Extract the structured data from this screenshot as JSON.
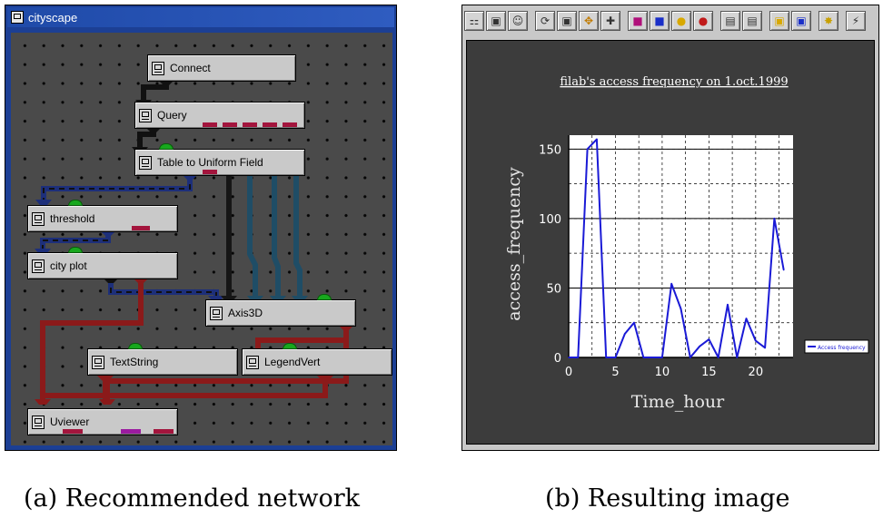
{
  "network_window": {
    "title": "cityscape",
    "modules": {
      "connect": "Connect",
      "query": "Query",
      "table": "Table to Uniform Field",
      "threshold": "threshold",
      "cityplot": "city plot",
      "axis": "Axis3D",
      "textstring": "TextString",
      "legend": "LegendVert",
      "uviewer": "Uviewer"
    },
    "colors": {
      "canvas": "#4a4a4a",
      "data_wire": "#1a1a1a",
      "field_wire": "#1d2f7a",
      "geometry_wire": "#1f4d66",
      "render_wire": "#8b1a1a",
      "input_port": "#18a81e"
    }
  },
  "viewer_window": {
    "toolbar_icons": [
      "zoom-icon",
      "camera-icon",
      "person-icon",
      "rotate-icon",
      "box-icon",
      "move-icon",
      "crosshair-icon",
      "cube-red-icon",
      "cube-blue-icon",
      "sphere-yellow-icon",
      "sphere-red-icon",
      "page-icon",
      "document-icon",
      "frame-icon",
      "frame-blue-icon",
      "light-icon",
      "lightning-icon"
    ]
  },
  "chart_data": {
    "type": "line",
    "title": "filab's access frequency on 1.oct.1999",
    "xlabel": "Time_hour",
    "ylabel": "access_frequency",
    "xlim": [
      0,
      24
    ],
    "ylim": [
      0,
      160
    ],
    "xticks": [
      0,
      5,
      10,
      15,
      20
    ],
    "yticks": [
      0,
      50,
      100,
      150
    ],
    "grid": true,
    "legend_position": "right",
    "series": [
      {
        "name": "Access frequency",
        "color": "#1a1ad6",
        "x": [
          0,
          1,
          2,
          3,
          4,
          5,
          6,
          7,
          8,
          9,
          10,
          11,
          12,
          13,
          14,
          15,
          16,
          17,
          18,
          19,
          20,
          21,
          22,
          23
        ],
        "y": [
          0,
          0,
          150,
          157,
          0,
          0,
          17,
          25,
          0,
          0,
          0,
          53,
          35,
          0,
          8,
          13,
          0,
          38,
          0,
          28,
          12,
          7,
          100,
          63
        ]
      }
    ]
  },
  "captions": {
    "left": "(a) Recommended network",
    "right": "(b) Resulting image"
  }
}
